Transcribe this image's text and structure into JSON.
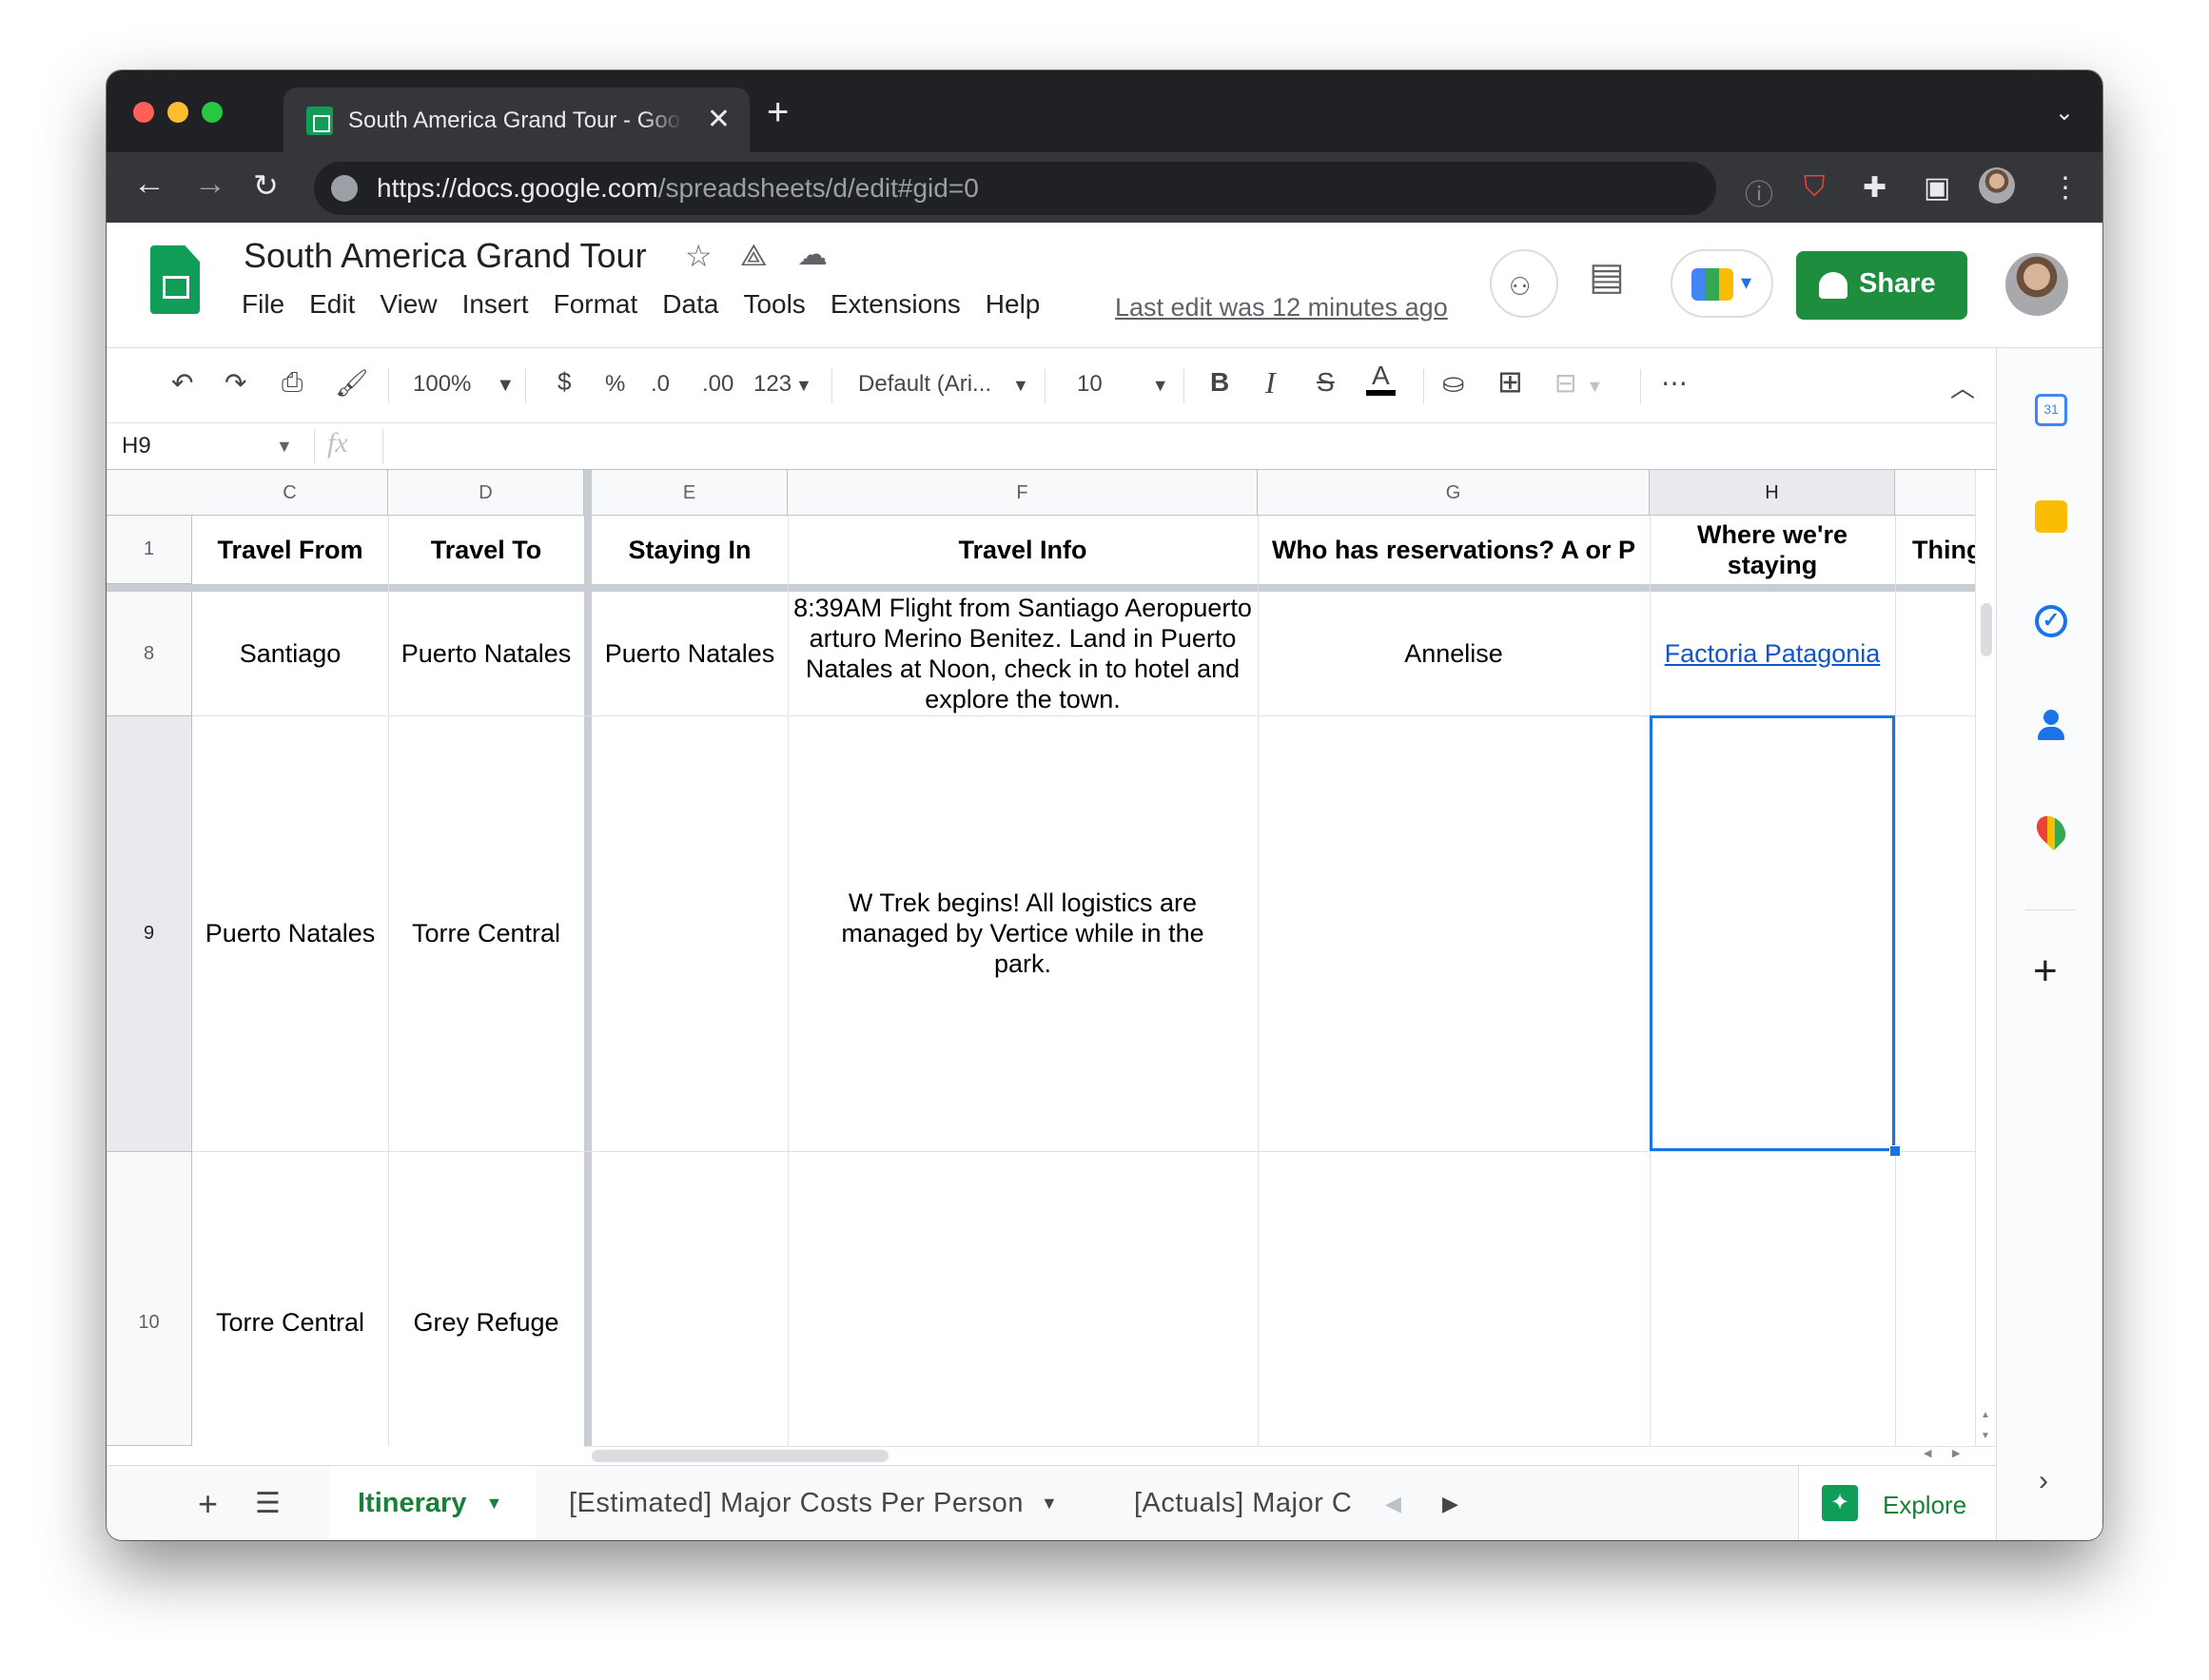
{
  "browser": {
    "tab_title": "South America Grand Tour - Google Sheets",
    "url_host": "https://docs.google.com",
    "url_path": "/spreadsheets/d/edit#gid=0"
  },
  "doc": {
    "title": "South America Grand Tour",
    "menu": [
      "File",
      "Edit",
      "View",
      "Insert",
      "Format",
      "Data",
      "Tools",
      "Extensions",
      "Help"
    ],
    "last_edit": "Last edit was 12 minutes ago",
    "share_label": "Share"
  },
  "toolbar": {
    "zoom": "100%",
    "currency": "$",
    "percent": "%",
    "dec_less": ".0",
    "dec_more": ".00",
    "num_format": "123",
    "font": "Default (Ari...",
    "font_size": "10",
    "bold": "B",
    "italic": "I",
    "strike": "S",
    "text_color": "A",
    "more": "⋯"
  },
  "formula_bar": {
    "name_box": "H9",
    "fx": "fx",
    "value": ""
  },
  "columns": [
    "C",
    "D",
    "E",
    "F",
    "G",
    "H"
  ],
  "header_row": {
    "num": "1",
    "cells": [
      "Travel From",
      "Travel To",
      "Staying In",
      "Travel Info",
      "Who has reservations? A or P",
      "Where we're staying",
      "Thing"
    ]
  },
  "rows": [
    {
      "num": "8",
      "cells": [
        "Santiago",
        "Puerto Natales",
        "Puerto Natales",
        "8:39AM Flight from Santiago Aeropuerto arturo Merino Benitez. Land in Puerto Natales at Noon, check in to hotel and explore the town.",
        "Annelise",
        "Factoria Patagonia"
      ]
    },
    {
      "num": "9",
      "cells": [
        "Puerto Natales",
        "Torre Central",
        "",
        "W Trek begins! All logistics are managed by Vertice while in the park.",
        "",
        ""
      ]
    },
    {
      "num": "10",
      "cells": [
        "Torre Central",
        "Grey Refuge",
        "",
        "",
        "",
        ""
      ]
    }
  ],
  "sheet_tabs": {
    "active": "Itinerary",
    "others": [
      "[Estimated] Major Costs Per Person",
      "[Actuals] Major C"
    ],
    "explore": "Explore"
  },
  "colors": {
    "share_green": "#1e8e3e",
    "selection_blue": "#1a73e8",
    "link_blue": "#1155cc"
  }
}
